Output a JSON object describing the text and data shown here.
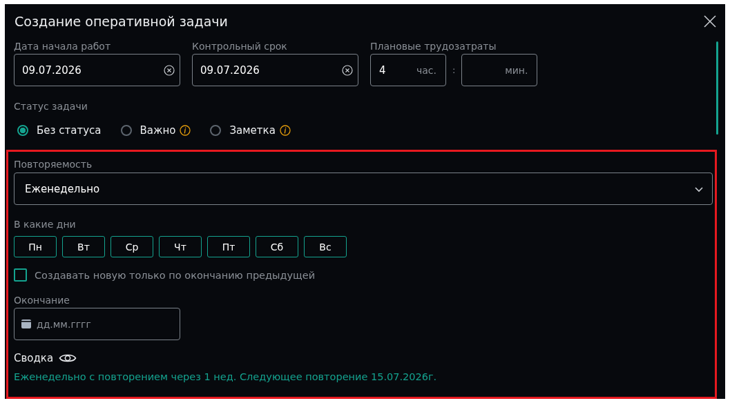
{
  "window": {
    "title": "Создание оперативной задачи"
  },
  "start_date": {
    "label": "Дата начала работ",
    "value": "09.07.2026"
  },
  "deadline": {
    "label": "Контрольный срок",
    "value": "09.07.2026"
  },
  "planned_effort": {
    "label": "Плановые трудозатраты",
    "hours": {
      "value": "4",
      "unit": "час."
    },
    "separator": ":",
    "minutes": {
      "unit": "мин."
    }
  },
  "status": {
    "label": "Статус задачи",
    "options": [
      {
        "label": "Без статуса",
        "selected": true,
        "info": false
      },
      {
        "label": "Важно",
        "selected": false,
        "info": true
      },
      {
        "label": "Заметка",
        "selected": false,
        "info": true
      }
    ]
  },
  "recurrence": {
    "label": "Повторяемость",
    "value": "Еженедельно"
  },
  "days": {
    "label": "В какие дни",
    "items": [
      {
        "label": "Пн",
        "selected": false
      },
      {
        "label": "Вт",
        "selected": false
      },
      {
        "label": "Ср",
        "selected": false
      },
      {
        "label": "Чт",
        "selected": false
      },
      {
        "label": "Пт",
        "selected": false
      },
      {
        "label": "Сб",
        "selected": false
      },
      {
        "label": "Вс",
        "selected": false
      }
    ]
  },
  "after_previous": {
    "label": "Создавать новую только по окончанию предыдущей",
    "checked": false
  },
  "end": {
    "label": "Окончание",
    "placeholder": "дд.мм.гггг"
  },
  "summary": {
    "label": "Сводка",
    "text": "Еженедельно с повторением через 1 нед. Следующее повторение 15.07.2026г."
  }
}
